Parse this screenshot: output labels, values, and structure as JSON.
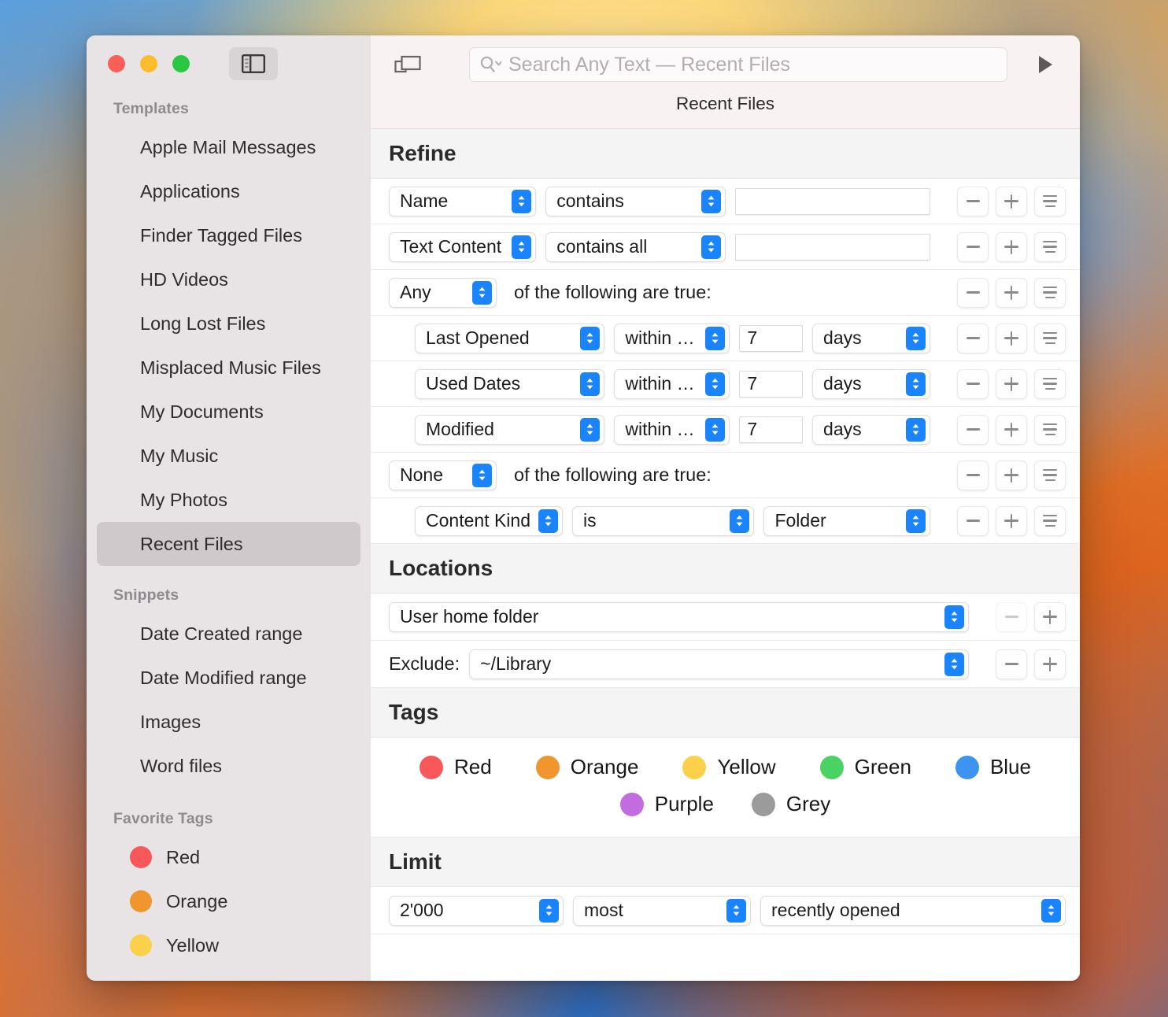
{
  "window": {
    "title": "Recent Files",
    "traffic_lights": [
      "close",
      "minimize",
      "zoom"
    ]
  },
  "toolbar": {
    "new_window_icon": "duplicate-window-icon",
    "sidebar_toggle_icon": "sidebar-toggle-icon",
    "search_placeholder": "Search Any Text — Recent Files",
    "search_value": "",
    "search_icon": "search-magnifier-icon",
    "run_icon": "play-triangle-icon",
    "doc_title": "Recent Files"
  },
  "sidebar": {
    "groups": [
      {
        "title": "Templates",
        "items": [
          {
            "label": "Apple Mail Messages",
            "selected": false
          },
          {
            "label": "Applications",
            "selected": false
          },
          {
            "label": "Finder Tagged Files",
            "selected": false
          },
          {
            "label": "HD Videos",
            "selected": false
          },
          {
            "label": "Long Lost Files",
            "selected": false
          },
          {
            "label": "Misplaced Music Files",
            "selected": false
          },
          {
            "label": "My Documents",
            "selected": false
          },
          {
            "label": "My Music",
            "selected": false
          },
          {
            "label": "My Photos",
            "selected": false
          },
          {
            "label": "Recent Files",
            "selected": true
          }
        ]
      },
      {
        "title": "Snippets",
        "items": [
          {
            "label": "Date Created range",
            "selected": false
          },
          {
            "label": "Date Modified range",
            "selected": false
          },
          {
            "label": "Images",
            "selected": false
          },
          {
            "label": "Word files",
            "selected": false
          }
        ]
      },
      {
        "title": "Favorite Tags",
        "tags": [
          {
            "label": "Red",
            "color": "#f8585a"
          },
          {
            "label": "Orange",
            "color": "#f0962f"
          },
          {
            "label": "Yellow",
            "color": "#fbd04a"
          }
        ]
      }
    ]
  },
  "sections": {
    "refine": {
      "header": "Refine",
      "rows": [
        {
          "kind": "criterion",
          "attribute": "Name",
          "operator": "contains",
          "value": "",
          "value_placeholder": ""
        },
        {
          "kind": "criterion",
          "attribute": "Text Content",
          "operator": "contains all",
          "value": "",
          "value_placeholder": ""
        },
        {
          "kind": "group",
          "quantifier": "Any",
          "suffix": "of the following are true:"
        },
        {
          "kind": "date",
          "attribute": "Last Opened",
          "operator": "within last",
          "amount": "7",
          "unit": "days"
        },
        {
          "kind": "date",
          "attribute": "Used Dates",
          "operator": "within last",
          "amount": "7",
          "unit": "days"
        },
        {
          "kind": "date",
          "attribute": "Modified",
          "operator": "within last",
          "amount": "7",
          "unit": "days"
        },
        {
          "kind": "group",
          "quantifier": "None",
          "suffix": "of the following are true:"
        },
        {
          "kind": "kind",
          "attribute": "Content Kind",
          "operator": "is",
          "value": "Folder"
        }
      ],
      "row_buttons": {
        "remove": "−",
        "add": "+",
        "options": "options-list-icon"
      }
    },
    "locations": {
      "header": "Locations",
      "include": {
        "value": "User home folder",
        "remove_enabled": false,
        "add_enabled": true
      },
      "exclude": {
        "label": "Exclude:",
        "value": "~/Library",
        "remove_enabled": true,
        "add_enabled": true
      }
    },
    "tags": {
      "header": "Tags",
      "row1": [
        {
          "label": "Red",
          "color": "#f8585a"
        },
        {
          "label": "Orange",
          "color": "#f0962f"
        },
        {
          "label": "Yellow",
          "color": "#fbd04a"
        },
        {
          "label": "Green",
          "color": "#4ad363"
        },
        {
          "label": "Blue",
          "color": "#3c94f0"
        }
      ],
      "row2": [
        {
          "label": "Purple",
          "color": "#c26ce0"
        },
        {
          "label": "Grey",
          "color": "#9b9b9b"
        }
      ]
    },
    "limit": {
      "header": "Limit",
      "count": "2'000",
      "superlative": "most",
      "order": "recently opened"
    }
  },
  "colors": {
    "accent_blue": "#1a84ff",
    "sidebar_bg": "#e8e4e6",
    "section_header_bg": "#f5f4f5",
    "toolbar_bg": "#f8f2f3"
  }
}
